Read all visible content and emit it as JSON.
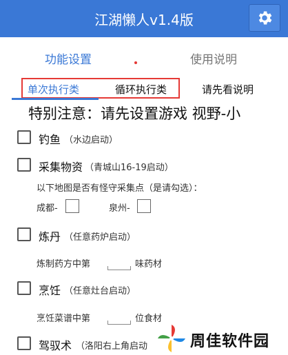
{
  "header": {
    "title": "江湖懒人v1.4版",
    "settings_icon": "gear-icon"
  },
  "main_tabs": [
    {
      "label": "功能设置",
      "active": true
    },
    {
      "label": "使用说明",
      "active": false
    }
  ],
  "sub_tabs": [
    {
      "label": "单次执行类",
      "active": true
    },
    {
      "label": "循环执行类",
      "active": false
    },
    {
      "label": "请先看说明",
      "active": false
    }
  ],
  "notice": "特别注意：请先设置游戏  视野-小",
  "items": {
    "fishing": {
      "label": "钓鱼",
      "hint": "（水边启动）",
      "checked": false
    },
    "gathering": {
      "label": "采集物资",
      "hint": "（青城山16-19启动）",
      "checked": false,
      "question": "以下地图是否有怪守采集点（是请勾选）：",
      "maps": [
        {
          "label": "成都-",
          "checked": false
        },
        {
          "label": "泉州-",
          "checked": false
        }
      ]
    },
    "alchemy": {
      "label": "炼丹",
      "hint": "（任意药炉启动）",
      "checked": false,
      "prefix": "炼制药方中第",
      "input_value": "",
      "suffix": "味药材"
    },
    "cooking": {
      "label": "烹饪",
      "hint": "（任意灶台启动）",
      "checked": false,
      "prefix": "烹饪菜谱中第",
      "input_value": "",
      "suffix": "位食材"
    },
    "driving": {
      "label": "驾驭术",
      "hint": "（洛阳右上角启动",
      "checked": false
    }
  },
  "watermark": {
    "text": "周佳软件园",
    "logo": "pinwheel-logo",
    "colors": [
      "#e53935",
      "#43a047",
      "#fbc02d",
      "#1e88e5"
    ]
  },
  "colors": {
    "accent": "#3a78d6",
    "highlight_box": "#e53935"
  }
}
